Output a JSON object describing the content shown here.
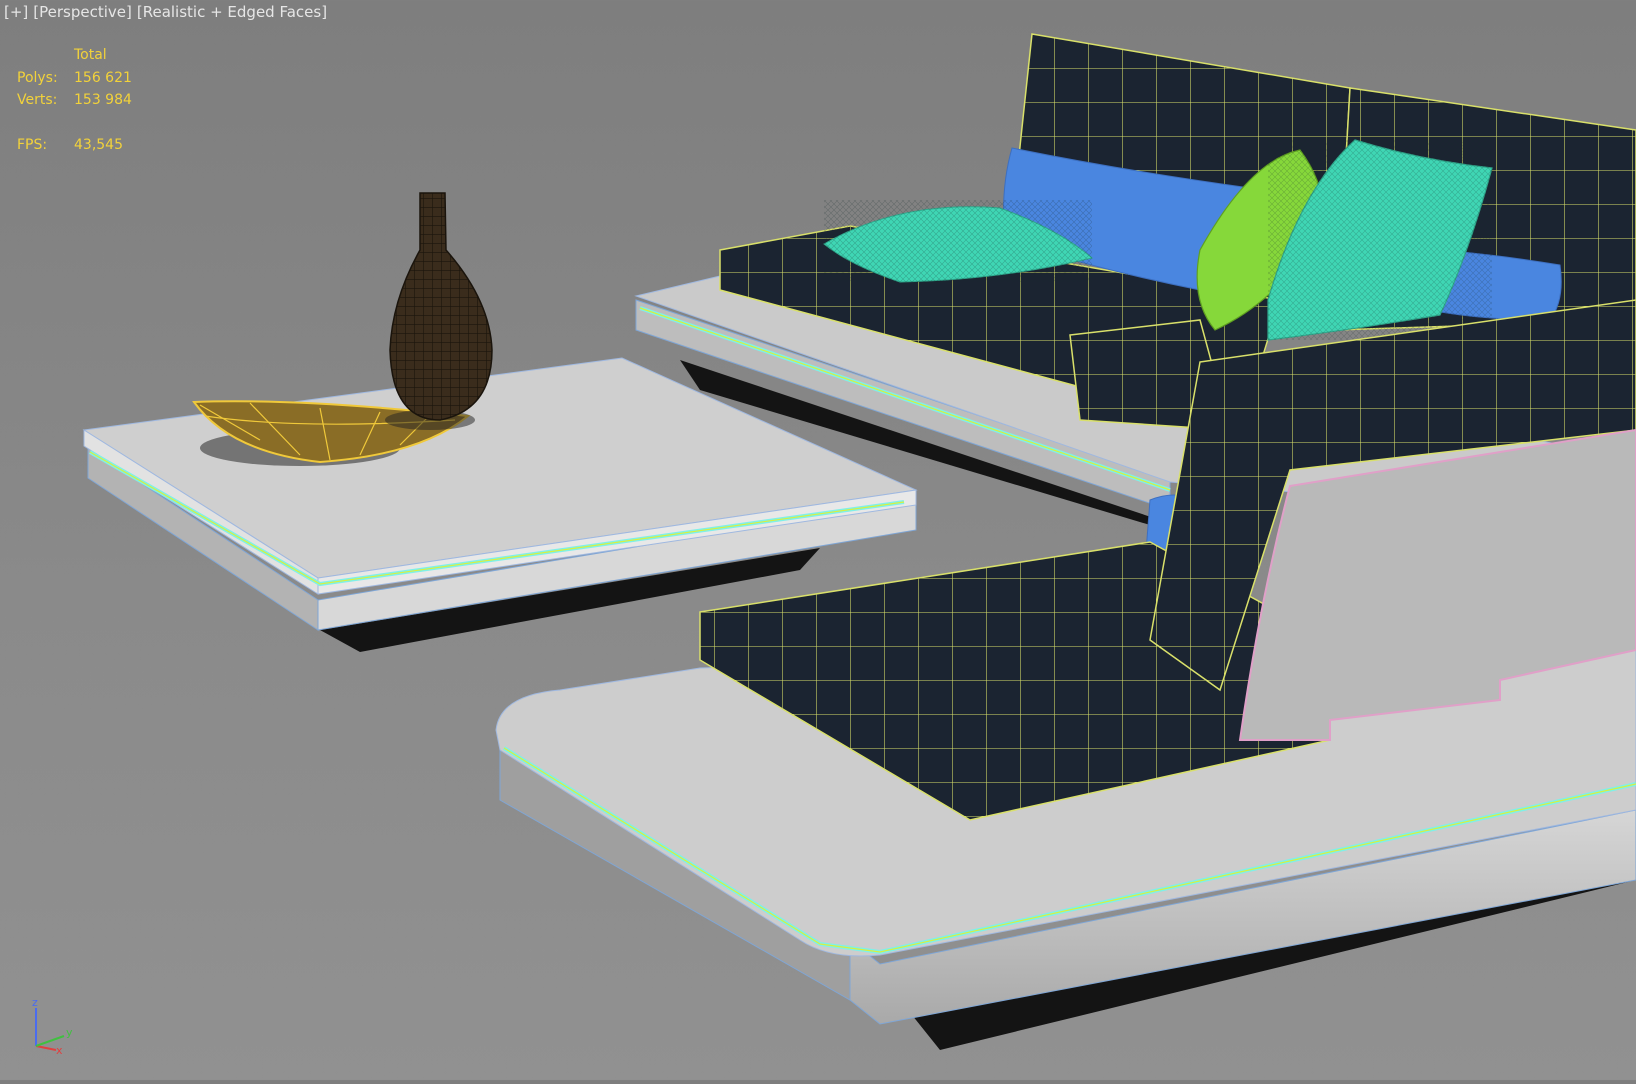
{
  "viewport_label": {
    "plus": "[+]",
    "view": "[Perspective]",
    "shading": "[Realistic + Edged Faces]"
  },
  "stats": {
    "header": "Total",
    "polys_label": "Polys:",
    "polys_value": "156 621",
    "verts_label": "Verts:",
    "verts_value": "153 984",
    "fps_label": "FPS:",
    "fps_value": "43,545"
  },
  "gizmo": {
    "z": "z",
    "x": "x",
    "y": "y"
  },
  "colors": {
    "viewport_bg": "#878787",
    "stats_text": "#f2d23a",
    "label_text": "#e6e6e6",
    "cushion": "#1c2533",
    "wire_yellow": "#d9e06a",
    "platform": "#c9c9c9",
    "pillow_teal": "#3fd6b4",
    "pillow_blue": "#4a86e0",
    "pillow_green": "#86d83a",
    "vase": "#2e2418",
    "bowl": "#9a7a2a"
  }
}
